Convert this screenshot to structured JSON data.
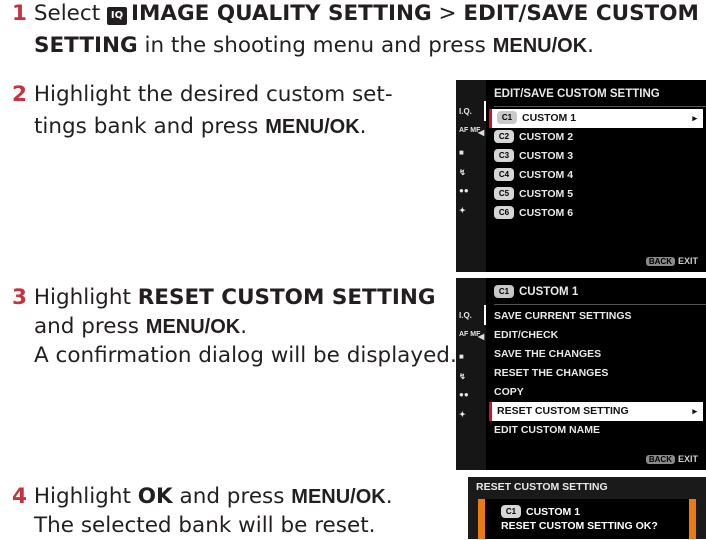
{
  "steps": {
    "s1": {
      "num": "1",
      "pre": "Select",
      "iq_badge": "IQ",
      "menu_a": "IMAGE QUALITY SETTING",
      "sep": ">",
      "menu_b_part1": "EDIT/SAVE CUSTOM",
      "menu_b_part2": "SETTING",
      "mid": "in the shooting menu and press",
      "key": "MENU/OK",
      "end": "."
    },
    "s2": {
      "num": "2",
      "line1": "Highlight the desired custom set-",
      "line2_pre": "tings bank and press",
      "key": "MENU/OK",
      "end": "."
    },
    "s3": {
      "num": "3",
      "pre": "Highlight",
      "item": "RESET CUSTOM SETTING",
      "line2_pre": "and press",
      "key": "MENU/OK",
      "end": ".",
      "line3": "A confirmation dialog will be displayed."
    },
    "s4": {
      "num": "4",
      "pre": "Highlight",
      "item": "OK",
      "mid": "and press",
      "key": "MENU/OK",
      "end": ".",
      "line2": "The selected bank will be reset."
    }
  },
  "screen1": {
    "title": "EDIT/SAVE CUSTOM SETTING",
    "side": [
      "I.Q.",
      "AF MF",
      "camera",
      "flash",
      "movie",
      "wrench"
    ],
    "items": [
      {
        "badge": "C1",
        "label": "CUSTOM 1"
      },
      {
        "badge": "C2",
        "label": "CUSTOM 2"
      },
      {
        "badge": "C3",
        "label": "CUSTOM 3"
      },
      {
        "badge": "C4",
        "label": "CUSTOM 4"
      },
      {
        "badge": "C5",
        "label": "CUSTOM 5"
      },
      {
        "badge": "C6",
        "label": "CUSTOM 6"
      }
    ],
    "foot_key": "BACK",
    "foot_label": "EXIT"
  },
  "screen2": {
    "header_badge": "C1",
    "header_label": "CUSTOM 1",
    "items": [
      "SAVE CURRENT SETTINGS",
      "EDIT/CHECK",
      "SAVE THE CHANGES",
      "RESET THE CHANGES",
      "COPY",
      "RESET CUSTOM SETTING",
      "EDIT CUSTOM NAME"
    ],
    "foot_key": "BACK",
    "foot_label": "EXIT"
  },
  "screen3": {
    "title": "RESET CUSTOM SETTING",
    "badge": "C1",
    "bank": "CUSTOM 1",
    "question": "RESET CUSTOM SETTING OK?"
  },
  "colors": {
    "step_number": "#c8313e",
    "selection_marker": "#d0102a",
    "dialog_border": "#e87c10"
  }
}
